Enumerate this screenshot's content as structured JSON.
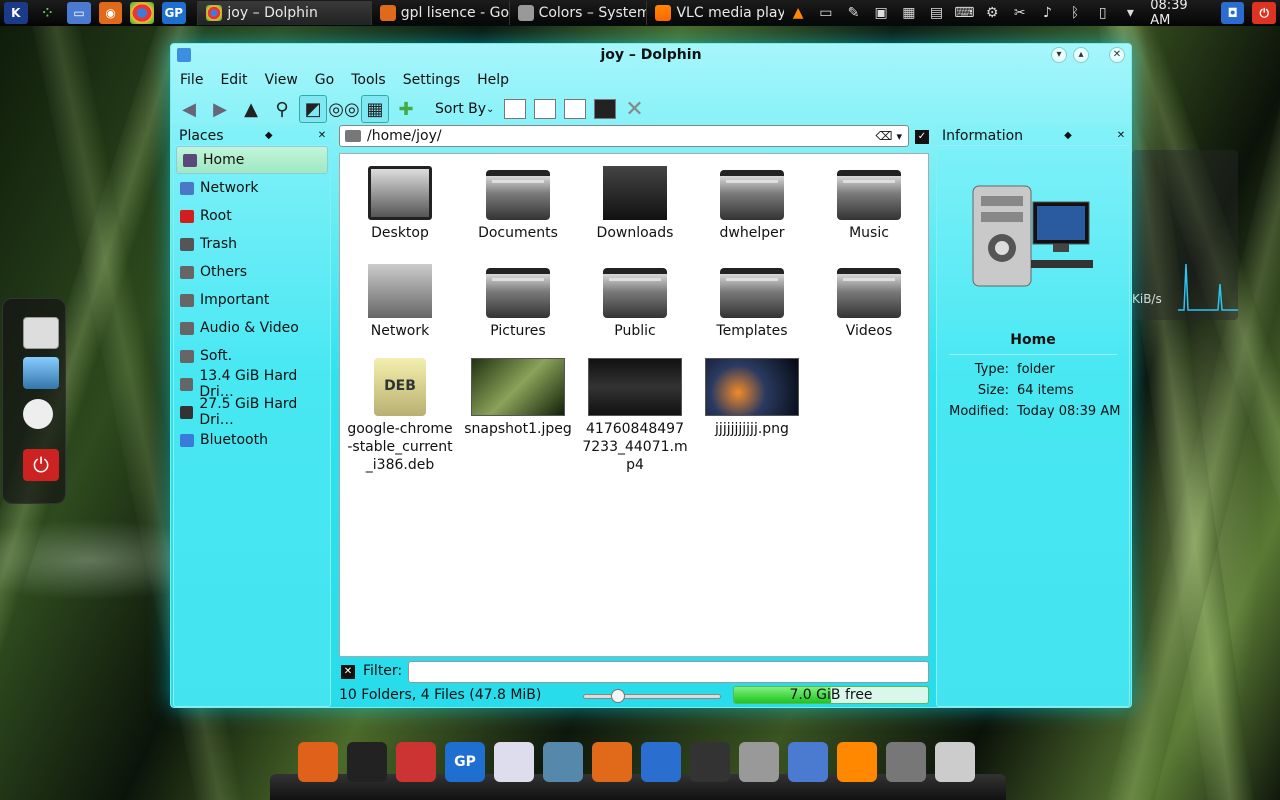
{
  "taskbar": {
    "start_icon": "kubuntu-logo-icon",
    "tasks": [
      {
        "label": "joy – Dolphin",
        "active": true,
        "icon": "chrome-icon"
      },
      {
        "label": "gpl lisence - Goo",
        "active": false,
        "icon": "firefox-icon"
      },
      {
        "label": "Colors – System",
        "active": false,
        "icon": "tools-icon"
      },
      {
        "label": "VLC media playe",
        "active": false,
        "icon": "vlc-icon"
      }
    ],
    "launchers": [
      "desktop-icon",
      "firefox-icon",
      "chrome-icon",
      "gp-icon",
      "chrome-small-icon"
    ],
    "gp_label": "GP",
    "clock": "08:39 AM"
  },
  "window": {
    "title": "joy – Dolphin",
    "menu": [
      "File",
      "Edit",
      "View",
      "Go",
      "Tools",
      "Settings",
      "Help"
    ],
    "toolbar": {
      "sort_by": "Sort By"
    },
    "places": {
      "title": "Places",
      "items": [
        {
          "label": "Home",
          "active": true,
          "color": "#5a4a7a"
        },
        {
          "label": "Network",
          "active": false,
          "color": "#4a78c8"
        },
        {
          "label": "Root",
          "active": false,
          "color": "#d21e1e"
        },
        {
          "label": "Trash",
          "active": false,
          "color": "#555"
        },
        {
          "label": "Others",
          "active": false,
          "color": "#666"
        },
        {
          "label": "Important",
          "active": false,
          "color": "#666"
        },
        {
          "label": "Audio & Video",
          "active": false,
          "color": "#666"
        },
        {
          "label": "Soft.",
          "active": false,
          "color": "#666"
        },
        {
          "label": "13.4 GiB Hard Dri…",
          "active": false,
          "color": "#666"
        },
        {
          "label": "27.5 GiB Hard Dri…",
          "active": false,
          "color": "#333"
        },
        {
          "label": "Bluetooth",
          "active": false,
          "color": "#3a7ad8"
        }
      ]
    },
    "location": {
      "path": "/home/joy/"
    },
    "files": [
      {
        "name": "Desktop",
        "kind": "monitor"
      },
      {
        "name": "Documents",
        "kind": "folder"
      },
      {
        "name": "Downloads",
        "kind": "downloads"
      },
      {
        "name": "dwhelper",
        "kind": "folder"
      },
      {
        "name": "Music",
        "kind": "folder"
      },
      {
        "name": "Network",
        "kind": "network"
      },
      {
        "name": "Pictures",
        "kind": "folder"
      },
      {
        "name": "Public",
        "kind": "folder"
      },
      {
        "name": "Templates",
        "kind": "folder"
      },
      {
        "name": "Videos",
        "kind": "folder"
      },
      {
        "name": "google-chrome-stable_current_i386.deb",
        "kind": "deb",
        "badge": "DEB"
      },
      {
        "name": "snapshot1.jpeg",
        "kind": "image"
      },
      {
        "name": "417608484977233_44071.mp4",
        "kind": "video"
      },
      {
        "name": "jjjjjjjjjjj.png",
        "kind": "space"
      }
    ],
    "filter": {
      "label": "Filter:",
      "value": ""
    },
    "status": {
      "summary": "10 Folders, 4 Files (47.8 MiB)",
      "free_space": "7.0 GiB free",
      "used_fraction": 0.5,
      "zoom_fraction": 0.25
    },
    "information": {
      "title": "Information",
      "name": "Home",
      "rows": [
        {
          "key": "Type:",
          "value": "folder"
        },
        {
          "key": "Size:",
          "value": "64 items"
        },
        {
          "key": "Modified:",
          "value": "Today 08:39 AM"
        }
      ]
    }
  },
  "desktop_widget": {
    "label": "KiB/s"
  },
  "dock": {
    "items": [
      "ubuntu-icon",
      "terminal-icon",
      "package-icon",
      "gp-icon",
      "document-icon",
      "globe-icon",
      "firefox-icon",
      "bird-icon",
      "pen-icon",
      "tools-icon",
      "file-manager-icon",
      "vlc-icon",
      "computer-icon",
      "printer-icon"
    ],
    "gp_label": "GP"
  }
}
